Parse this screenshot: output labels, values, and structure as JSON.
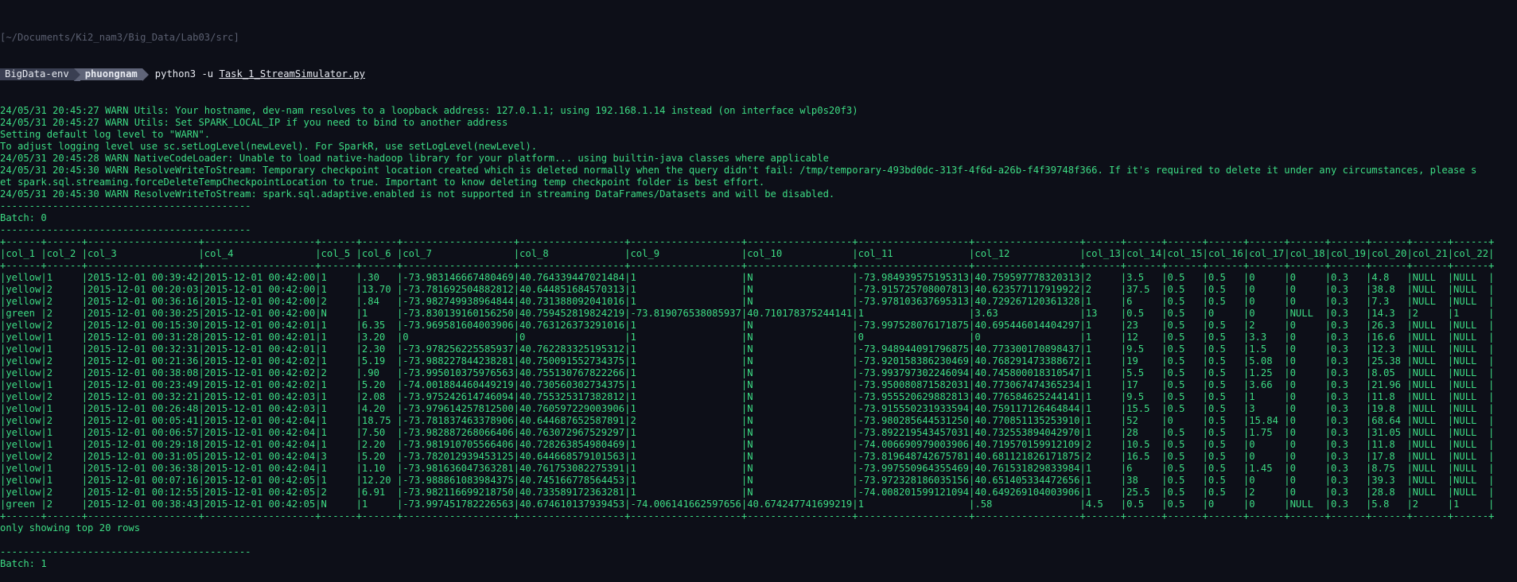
{
  "terminal": {
    "cwd": "[~/Documents/Ki2_nam3/Big_Data/Lab03/src]",
    "env_name": "BigData-env",
    "user": "phuongnam",
    "command": "python3 -u",
    "script": "Task_1_StreamSimulator.py",
    "lines": [
      "24/05/31 20:45:27 WARN Utils: Your hostname, dev-nam resolves to a loopback address: 127.0.1.1; using 192.168.1.14 instead (on interface wlp0s20f3)",
      "24/05/31 20:45:27 WARN Utils: Set SPARK_LOCAL_IP if you need to bind to another address",
      "Setting default log level to \"WARN\".",
      "To adjust logging level use sc.setLogLevel(newLevel). For SparkR, use setLogLevel(newLevel).",
      "24/05/31 20:45:28 WARN NativeCodeLoader: Unable to load native-hadoop library for your platform... using builtin-java classes where applicable",
      "24/05/31 20:45:30 WARN ResolveWriteToStream: Temporary checkpoint location created which is deleted normally when the query didn't fail: /tmp/temporary-493bd0dc-313f-4f6d-a26b-f4f39748f366. If it's required to delete it under any circumstances, please s",
      "et spark.sql.streaming.forceDeleteTempCheckpointLocation to true. Important to know deleting temp checkpoint folder is best effort.",
      "24/05/31 20:45:30 WARN ResolveWriteToStream: spark.sql.adaptive.enabled is not supported in streaming DataFrames/Datasets and will be disabled.",
      "-------------------------------------------",
      "Batch: 0",
      "-------------------------------------------",
      "+------+------+-------------------+-------------------+------+------+-------------------+------------------+-------------------+------------------+-------------------+------------------+------+------+------+------+------+------+------+------+------+------+",
      "|col_1 |col_2 |col_3              |col_4              |col_5 |col_6 |col_7              |col_8             |col_9              |col_10            |col_11             |col_12            |col_13|col_14|col_15|col_16|col_17|col_18|col_19|col_20|col_21|col_22|",
      "+------+------+-------------------+-------------------+------+------+-------------------+------------------+-------------------+------------------+-------------------+------------------+------+------+------+------+------+------+------+------+------+------+",
      "|yellow|1     |2015-12-01 00:39:42|2015-12-01 00:42:00|1     |.30   |-73.983146667480469|40.764339447021484|1                  |N                 |-73.984939575195313|40.759597778320313|2     |3.5   |0.5   |0.5   |0     |0     |0.3   |4.8   |NULL  |NULL  |",
      "|yellow|2     |2015-12-01 00:20:03|2015-12-01 00:42:00|1     |13.70 |-73.781692504882812|40.644851684570313|1                  |N                 |-73.915725708007813|40.623577117919922|2     |37.5  |0.5   |0.5   |0     |0     |0.3   |38.8  |NULL  |NULL  |",
      "|yellow|2     |2015-12-01 00:36:16|2015-12-01 00:42:00|2     |.84   |-73.982749938964844|40.731388092041016|1                  |N                 |-73.978103637695313|40.729267120361328|1     |6     |0.5   |0.5   |0     |0     |0.3   |7.3   |NULL  |NULL  |",
      "|green |2     |2015-12-01 00:30:25|2015-12-01 00:42:00|N     |1     |-73.830139160156250|40.759452819824219|-73.819076538085937|40.710178375244141|1                  |3.63              |13    |0.5   |0.5   |0     |0     |NULL  |0.3   |14.3  |2     |1     |",
      "|yellow|2     |2015-12-01 00:15:30|2015-12-01 00:42:01|1     |6.35  |-73.969581604003906|40.763126373291016|1                  |N                 |-73.997528076171875|40.695446014404297|1     |23    |0.5   |0.5   |2     |0     |0.3   |26.3  |NULL  |NULL  |",
      "|yellow|1     |2015-12-01 00:31:28|2015-12-01 00:42:01|1     |3.20  |0                  |0                 |1                  |N                 |0                  |0                 |1     |12    |0.5   |0.5   |3.3   |0     |0.3   |16.6  |NULL  |NULL  |",
      "|yellow|1     |2015-12-01 00:32:31|2015-12-01 00:42:01|1     |2.30  |-73.978256225585937|40.762283325195312|1                  |N                 |-73.948944091796875|40.773300170898437|1     |9.5   |0.5   |0.5   |1.5   |0     |0.3   |12.3  |NULL  |NULL  |",
      "|yellow|2     |2015-12-01 00:21:36|2015-12-01 00:42:02|1     |5.19  |-73.988227844238281|40.750091552734375|1                  |N                 |-73.920158386230469|40.768291473388672|1     |19    |0.5   |0.5   |5.08  |0     |0.3   |25.38 |NULL  |NULL  |",
      "|yellow|2     |2015-12-01 00:38:08|2015-12-01 00:42:02|2     |.90   |-73.995010375976563|40.755130767822266|1                  |N                 |-73.993797302246094|40.745800018310547|1     |5.5   |0.5   |0.5   |1.25  |0     |0.3   |8.05  |NULL  |NULL  |",
      "|yellow|1     |2015-12-01 00:23:49|2015-12-01 00:42:02|1     |5.20  |-74.001884460449219|40.730560302734375|1                  |N                 |-73.950080871582031|40.773067474365234|1     |17    |0.5   |0.5   |3.66  |0     |0.3   |21.96 |NULL  |NULL  |",
      "|yellow|2     |2015-12-01 00:32:21|2015-12-01 00:42:03|1     |2.08  |-73.975242614746094|40.755325317382812|1                  |N                 |-73.955520629882813|40.776584625244141|1     |9.5   |0.5   |0.5   |1     |0     |0.3   |11.8  |NULL  |NULL  |",
      "|yellow|1     |2015-12-01 00:26:48|2015-12-01 00:42:03|1     |4.20  |-73.979614257812500|40.760597229003906|1                  |N                 |-73.915550231933594|40.759117126464844|1     |15.5  |0.5   |0.5   |3     |0     |0.3   |19.8  |NULL  |NULL  |",
      "|yellow|2     |2015-12-01 00:05:41|2015-12-01 00:42:04|1     |18.75 |-73.781837463378906|40.644687652587891|2                  |N                 |-73.980285644531250|40.770851135253910|1     |52    |0     |0.5   |15.84 |0     |0.3   |68.64 |NULL  |NULL  |",
      "|yellow|1     |2015-12-01 00:06:57|2015-12-01 00:42:04|1     |7.50  |-73.982887268066406|40.763072967529297|1                  |N                 |-73.892219543457031|40.732553894042970|1     |28    |0.5   |0.5   |1.75  |0     |0.3   |31.05 |NULL  |NULL  |",
      "|yellow|1     |2015-12-01 00:29:18|2015-12-01 00:42:04|1     |2.20  |-73.981910705566406|40.728263854980469|1                  |N                 |-74.006690979003906|40.719570159912109|2     |10.5  |0.5   |0.5   |0     |0     |0.3   |11.8  |NULL  |NULL  |",
      "|yellow|2     |2015-12-01 00:31:05|2015-12-01 00:42:04|3     |5.20  |-73.782012939453125|40.644668579101563|1                  |N                 |-73.819648742675781|40.681121826171875|2     |16.5  |0.5   |0.5   |0     |0     |0.3   |17.8  |NULL  |NULL  |",
      "|yellow|1     |2015-12-01 00:36:38|2015-12-01 00:42:04|1     |1.10  |-73.981636047363281|40.761753082275391|1                  |N                 |-73.997550964355469|40.761531829833984|1     |6     |0.5   |0.5   |1.45  |0     |0.3   |8.75  |NULL  |NULL  |",
      "|yellow|1     |2015-12-01 00:07:16|2015-12-01 00:42:05|1     |12.20 |-73.988861083984375|40.745166778564453|1                  |N                 |-73.972328186035156|40.651405334472656|1     |38    |0.5   |0.5   |0     |0     |0.3   |39.3  |NULL  |NULL  |",
      "|yellow|2     |2015-12-01 00:12:55|2015-12-01 00:42:05|2     |6.91  |-73.982116699218750|40.733589172363281|1                  |N                 |-74.008201599121094|40.649269104003906|1     |25.5  |0.5   |0.5   |2     |0     |0.3   |28.8  |NULL  |NULL  |",
      "|green |2     |2015-12-01 00:38:43|2015-12-01 00:42:05|N     |1     |-73.997451782226563|40.674610137939453|-74.006141662597656|40.674247741699219|1                  |.58               |4.5   |0.5   |0.5   |0     |0     |NULL  |0.3   |5.8   |2     |1     |",
      "+------+------+-------------------+-------------------+------+------+-------------------+------------------+-------------------+------------------+-------------------+------------------+------+------+------+------+------+------+------+------+------+------+",
      "only showing top 20 rows",
      "",
      "-------------------------------------------",
      "Batch: 1"
    ]
  }
}
